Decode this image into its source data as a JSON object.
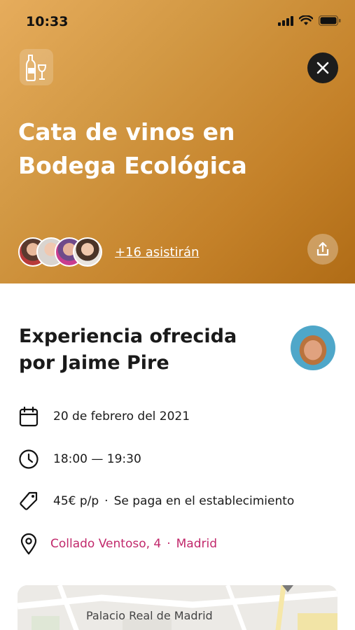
{
  "status": {
    "time": "10:33"
  },
  "hero": {
    "title": "Cata de vinos en Bodega Ecológica",
    "attendees_text": "+16 asistirán",
    "category_icon": "wine-icon",
    "close_icon": "close-icon",
    "share_icon": "share-icon"
  },
  "host": {
    "title": "Experiencia ofrecida por Jaime Pire"
  },
  "details": {
    "date": "20 de febrero del 2021",
    "time": "18:00 — 19:30",
    "price": "45€ p/p",
    "payment": "Se paga en el establecimiento",
    "address": "Collado Ventoso, 4",
    "city": "Madrid",
    "separator": "·"
  },
  "map": {
    "label": "Palacio Real de Madrid"
  },
  "colors": {
    "accent": "#c1286b",
    "hero_start": "#e6ac5c",
    "hero_end": "#b06c16",
    "close_bg": "#1c1c1c"
  }
}
